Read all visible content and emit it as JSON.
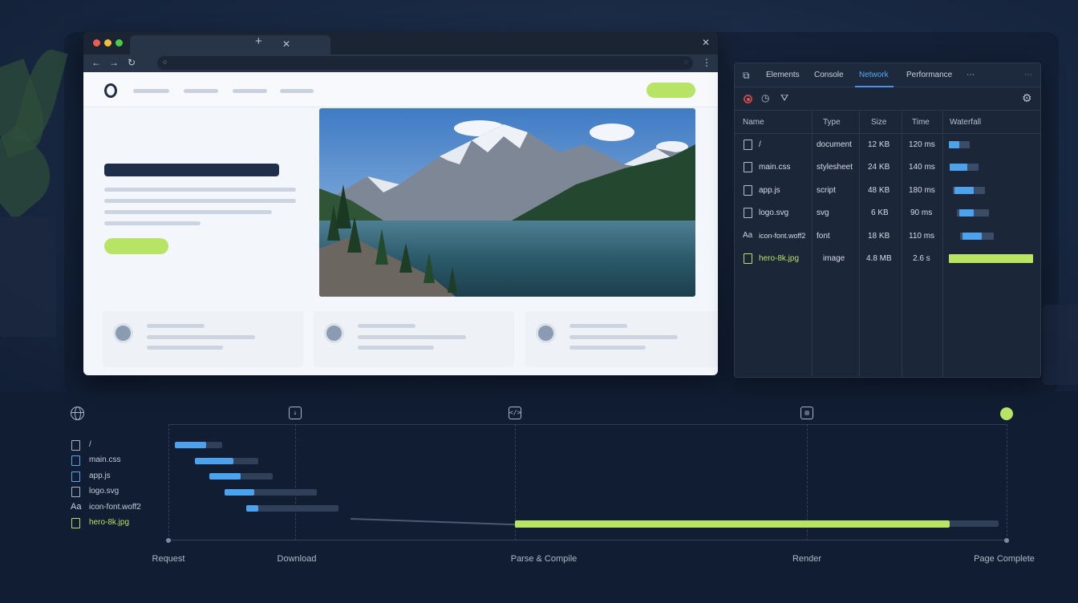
{
  "devtools": {
    "tabs": [
      "Elements",
      "Console",
      "Network",
      "Performance",
      "⋯"
    ],
    "active_tab": "Network",
    "more_menu": "⋯",
    "columns": [
      "Name",
      "Type",
      "Size",
      "Time",
      "Waterfall"
    ],
    "requests": [
      {
        "name": "/",
        "type": "document",
        "size": "12 KB",
        "time": "120 ms",
        "icon": "file-icon",
        "wf_start": 0.0,
        "wf_end": 0.11
      },
      {
        "name": "main.css",
        "type": "stylesheet",
        "size": "24 KB",
        "time": "140 ms",
        "icon": "css-file-icon",
        "wf_start": 0.0,
        "wf_end": 0.13
      },
      {
        "name": "app.js",
        "type": "script",
        "size": "48 KB",
        "time": "180 ms",
        "icon": "js-file-icon",
        "wf_start": 0.04,
        "wf_end": 0.17
      },
      {
        "name": "logo.svg",
        "type": "svg",
        "size": "6 KB",
        "time": "90 ms",
        "icon": "image-icon",
        "wf_start": 0.1,
        "wf_end": 0.14
      },
      {
        "name": "icon-font.woff2",
        "type": "font",
        "size": "18 KB",
        "time": "110 ms",
        "icon": "font-icon",
        "wf_start": 0.14,
        "wf_end": 0.2
      },
      {
        "name": "hero-8k.jpg",
        "type": "image",
        "size": "4.8 MB",
        "time": "2.6 s",
        "icon": "image-icon",
        "wf_start": 0.0,
        "wf_end": 1.0
      }
    ]
  },
  "timeline": {
    "stages": [
      "Request",
      "Download",
      "Parse & Compile",
      "Render",
      "Page Complete"
    ],
    "resources": [
      {
        "label": "/",
        "icon": "file-icon"
      },
      {
        "label": "main.css",
        "icon": "css-file-icon"
      },
      {
        "label": "app.js",
        "icon": "js-file-icon"
      },
      {
        "label": "logo.svg",
        "icon": "image-icon"
      },
      {
        "label": "icon-font.woff2",
        "icon": "font-icon"
      },
      {
        "label": "hero-8k.jpg",
        "icon": "image-icon"
      }
    ]
  },
  "icons": {
    "font_glyph": "Aa",
    "download_glyph": "↓",
    "parse_glyph": "</>",
    "render_glyph": "▤"
  },
  "colors": {
    "accent_green": "#b8e465",
    "accent_blue": "#4da2ee",
    "devtools_active_tab": "#5aa6f4"
  }
}
